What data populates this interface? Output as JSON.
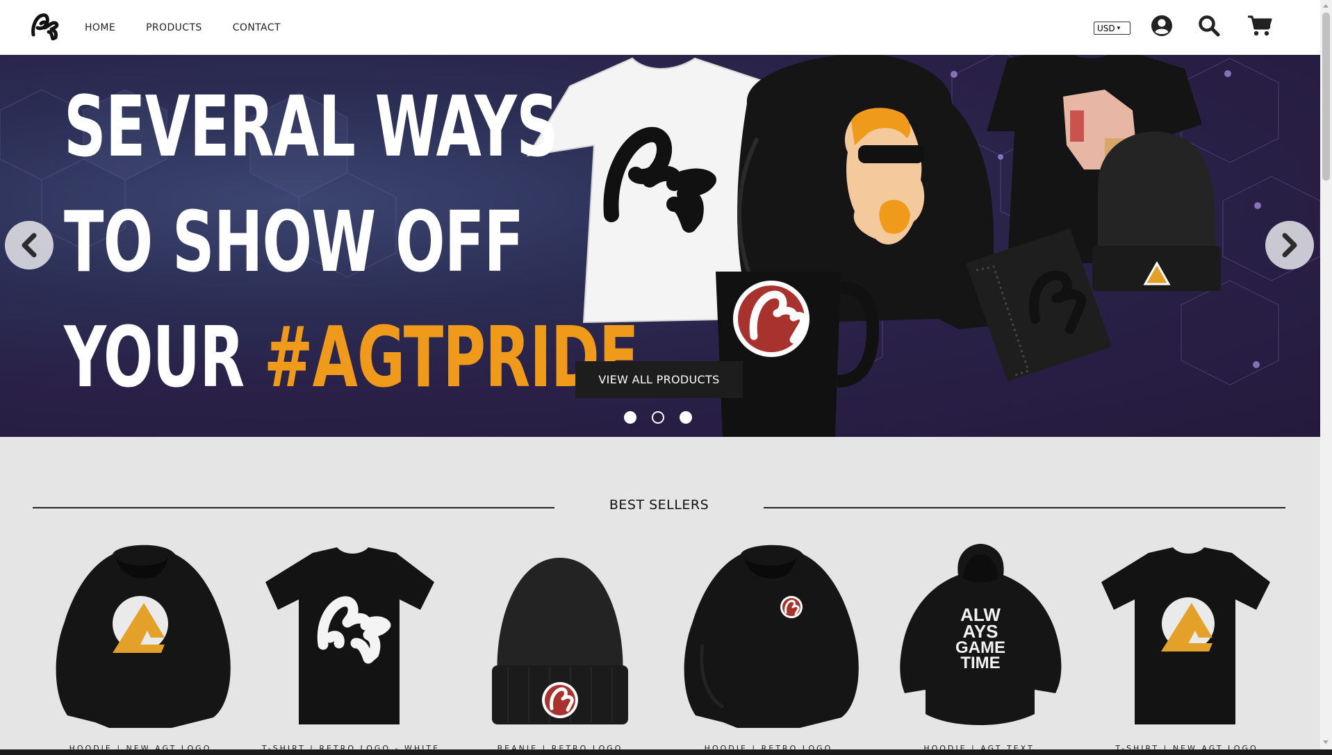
{
  "header": {
    "logo_text": "AGT",
    "nav": [
      {
        "label": "HOME"
      },
      {
        "label": "PRODUCTS"
      },
      {
        "label": "CONTACT"
      }
    ],
    "currency": {
      "selected": "USD"
    },
    "icons": [
      "account-icon",
      "search-icon",
      "cart-icon"
    ]
  },
  "hero": {
    "title_line1": "SEVERAL WAYS",
    "title_line2": "TO SHOW OFF",
    "title_line3_prefix": "YOUR ",
    "title_line3_accent": "#AGTPRIDE",
    "accent_color": "#f09a1c",
    "cta_label": "VIEW ALL PRODUCTS",
    "slides_count": 3,
    "active_slide": 2
  },
  "best_sellers": {
    "title": "BEST SELLERS",
    "products": [
      {
        "name": "HOODIE | NEW AGT LOGO",
        "type": "hoodie",
        "graphic": "triangle-logo"
      },
      {
        "name": "T-SHIRT | RETRO LOGO - WHITE",
        "type": "tshirt",
        "graphic": "retro-logo-white"
      },
      {
        "name": "BEANIE | RETRO LOGO",
        "type": "beanie",
        "graphic": "retro-badge"
      },
      {
        "name": "HOODIE | RETRO LOGO",
        "type": "hoodie",
        "graphic": "retro-badge-small"
      },
      {
        "name": "HOODIE | AGT TEXT",
        "type": "hoodie-back",
        "graphic": "always-game-time"
      },
      {
        "name": "T-SHIRT | NEW AGT LOGO",
        "type": "tshirt",
        "graphic": "triangle-logo"
      }
    ],
    "back_print_text": [
      "ALW",
      "AYS",
      "GAME",
      "TIME"
    ]
  }
}
